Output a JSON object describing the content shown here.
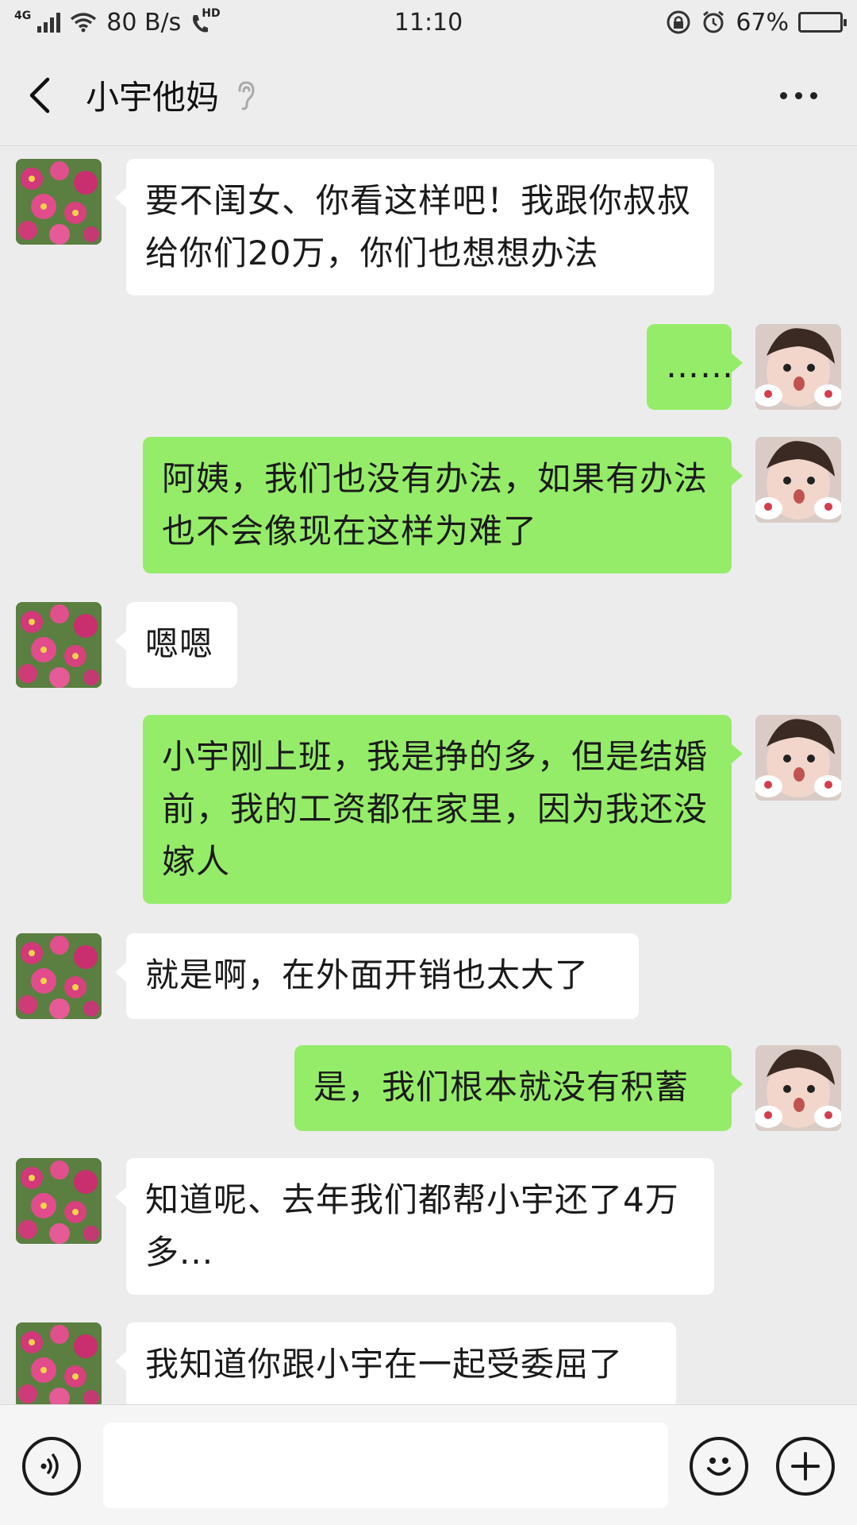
{
  "status_bar": {
    "network": "4G",
    "speed": "80 B/s",
    "hd": "HD",
    "time": "11:10",
    "battery_percent": "67%",
    "battery_level": 0.67
  },
  "header": {
    "title": "小宇他妈",
    "back_icon": "chevron-left-icon",
    "ear_icon": "ear-icon",
    "more_icon": "more-icon"
  },
  "messages": [
    {
      "side": "in",
      "text": "要不闺女、你看这样吧！我跟你叔叔给你们20万，你们也想想办法"
    },
    {
      "side": "out",
      "text": "……"
    },
    {
      "side": "out",
      "text": "阿姨，我们也没有办法，如果有办法也不会像现在这样为难了"
    },
    {
      "side": "in",
      "text": "嗯嗯"
    },
    {
      "side": "out",
      "text": "小宇刚上班，我是挣的多，但是结婚前，我的工资都在家里，因为我还没嫁人"
    },
    {
      "side": "in",
      "text": "就是啊，在外面开销也太大了"
    },
    {
      "side": "out",
      "text": "是，我们根本就没有积蓄"
    },
    {
      "side": "in",
      "text": "知道呢、去年我们都帮小宇还了4万多..."
    },
    {
      "side": "in",
      "text": "我知道你跟小宇在一起受委屈了"
    }
  ],
  "input_bar": {
    "voice_icon": "voice-icon",
    "emoji_icon": "emoji-icon",
    "plus_icon": "plus-icon",
    "input_value": ""
  },
  "colors": {
    "incoming_bubble": "#ffffff",
    "outgoing_bubble": "#95ec69",
    "background": "#ececec"
  }
}
